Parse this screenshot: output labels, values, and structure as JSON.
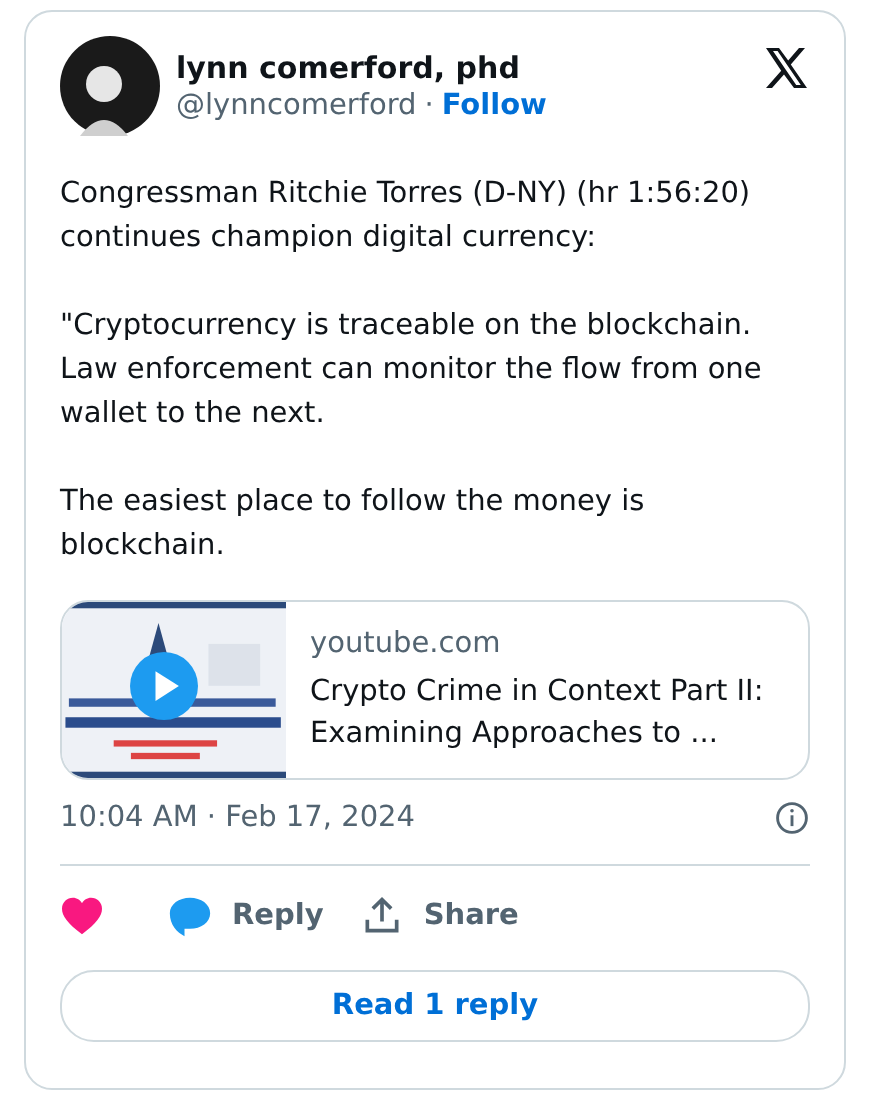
{
  "author": {
    "name": "lynn comerford, phd",
    "handle": "@lynncomerford",
    "separator": "·",
    "follow": "Follow"
  },
  "paragraphs": [
    "Congressman Ritchie Torres (D-NY) (hr 1:56:20) continues champion digital currency:",
    "\"Cryptocurrency is traceable on the blockchain. Law enforcement can monitor the flow from one wallet to the next.",
    "The easiest place to follow the money is blockchain."
  ],
  "link_card": {
    "domain": "youtube.com",
    "title": "Crypto Crime in Context Part II: Examining Approaches to ..."
  },
  "timestamp": "10:04 AM · Feb 17, 2024",
  "actions": [
    {
      "kind": "like"
    },
    {
      "kind": "reply",
      "label": "Reply"
    },
    {
      "kind": "share",
      "label": "Share"
    }
  ],
  "read_replies": "Read 1 reply"
}
